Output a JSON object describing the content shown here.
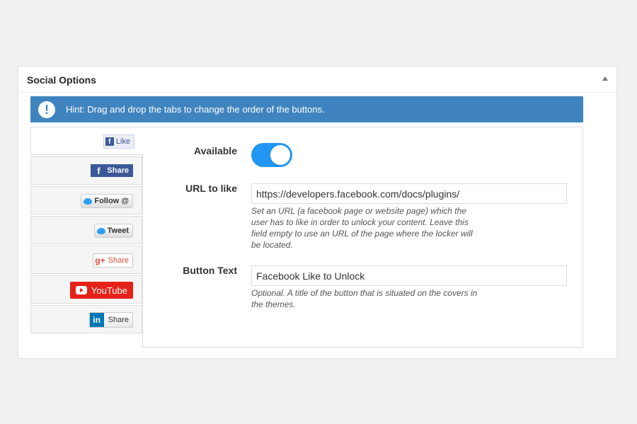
{
  "panel": {
    "title": "Social Options"
  },
  "hint": {
    "icon": "exclamation-icon",
    "glyph": "!",
    "text": "Hint: Drag and drop the tabs to change the order of the buttons."
  },
  "tabs": [
    {
      "id": "facebook-like",
      "label": "Like",
      "glyph": "f"
    },
    {
      "id": "facebook-share",
      "label": "Share",
      "glyph": "f"
    },
    {
      "id": "twitter-follow",
      "label": "Follow @"
    },
    {
      "id": "twitter-tweet",
      "label": "Tweet"
    },
    {
      "id": "google-share",
      "label": "Share",
      "glyph": "g+"
    },
    {
      "id": "youtube",
      "label": "YouTube"
    },
    {
      "id": "linkedin-share",
      "label": "Share",
      "glyph": "in"
    }
  ],
  "form": {
    "available": {
      "label": "Available",
      "on": true
    },
    "url": {
      "label": "URL to like",
      "value": "https://developers.facebook.com/docs/plugins/",
      "help": "Set an URL (a facebook page or website page) which the user has to like in order to unlock your content. Leave this field empty to use an URL of the page where the locker will be located."
    },
    "button_text": {
      "label": "Button Text",
      "value": "Facebook Like to Unlock",
      "help": "Optional. A title of the button that is situated on the covers in the themes."
    }
  },
  "colors": {
    "accent": "#3f84bf",
    "toggle": "#2196f3",
    "youtube": "#e62117",
    "facebook": "#3b5998",
    "linkedin": "#0077b5"
  }
}
